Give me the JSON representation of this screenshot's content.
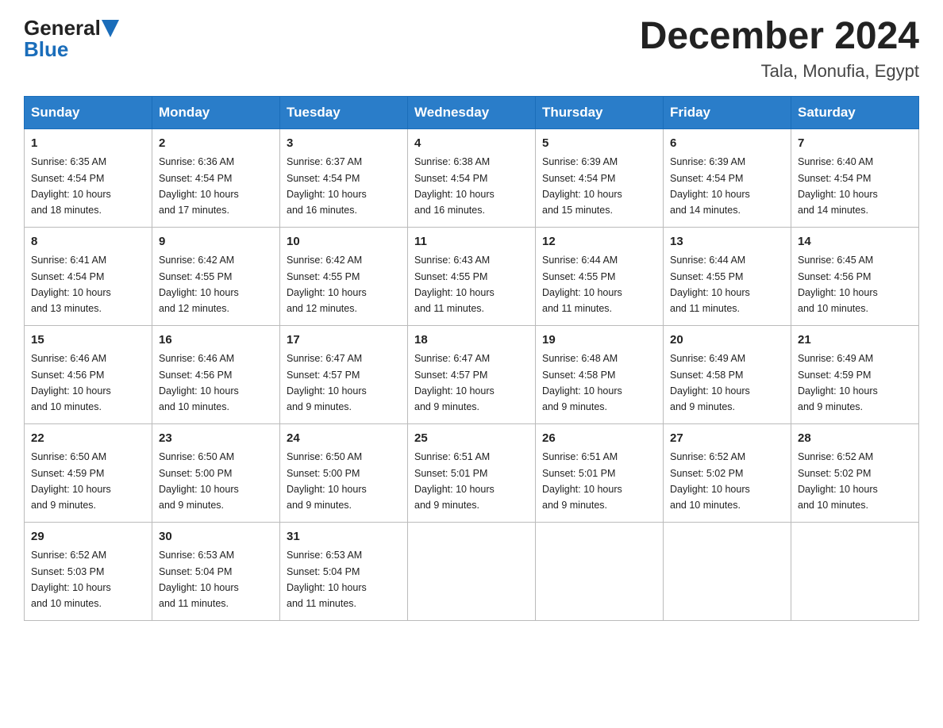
{
  "header": {
    "logo_general": "General",
    "logo_blue": "Blue",
    "title": "December 2024",
    "subtitle": "Tala, Monufia, Egypt"
  },
  "weekdays": [
    "Sunday",
    "Monday",
    "Tuesday",
    "Wednesday",
    "Thursday",
    "Friday",
    "Saturday"
  ],
  "weeks": [
    [
      {
        "day": "1",
        "sunrise": "6:35 AM",
        "sunset": "4:54 PM",
        "daylight": "10 hours and 18 minutes."
      },
      {
        "day": "2",
        "sunrise": "6:36 AM",
        "sunset": "4:54 PM",
        "daylight": "10 hours and 17 minutes."
      },
      {
        "day": "3",
        "sunrise": "6:37 AM",
        "sunset": "4:54 PM",
        "daylight": "10 hours and 16 minutes."
      },
      {
        "day": "4",
        "sunrise": "6:38 AM",
        "sunset": "4:54 PM",
        "daylight": "10 hours and 16 minutes."
      },
      {
        "day": "5",
        "sunrise": "6:39 AM",
        "sunset": "4:54 PM",
        "daylight": "10 hours and 15 minutes."
      },
      {
        "day": "6",
        "sunrise": "6:39 AM",
        "sunset": "4:54 PM",
        "daylight": "10 hours and 14 minutes."
      },
      {
        "day": "7",
        "sunrise": "6:40 AM",
        "sunset": "4:54 PM",
        "daylight": "10 hours and 14 minutes."
      }
    ],
    [
      {
        "day": "8",
        "sunrise": "6:41 AM",
        "sunset": "4:54 PM",
        "daylight": "10 hours and 13 minutes."
      },
      {
        "day": "9",
        "sunrise": "6:42 AM",
        "sunset": "4:55 PM",
        "daylight": "10 hours and 12 minutes."
      },
      {
        "day": "10",
        "sunrise": "6:42 AM",
        "sunset": "4:55 PM",
        "daylight": "10 hours and 12 minutes."
      },
      {
        "day": "11",
        "sunrise": "6:43 AM",
        "sunset": "4:55 PM",
        "daylight": "10 hours and 11 minutes."
      },
      {
        "day": "12",
        "sunrise": "6:44 AM",
        "sunset": "4:55 PM",
        "daylight": "10 hours and 11 minutes."
      },
      {
        "day": "13",
        "sunrise": "6:44 AM",
        "sunset": "4:55 PM",
        "daylight": "10 hours and 11 minutes."
      },
      {
        "day": "14",
        "sunrise": "6:45 AM",
        "sunset": "4:56 PM",
        "daylight": "10 hours and 10 minutes."
      }
    ],
    [
      {
        "day": "15",
        "sunrise": "6:46 AM",
        "sunset": "4:56 PM",
        "daylight": "10 hours and 10 minutes."
      },
      {
        "day": "16",
        "sunrise": "6:46 AM",
        "sunset": "4:56 PM",
        "daylight": "10 hours and 10 minutes."
      },
      {
        "day": "17",
        "sunrise": "6:47 AM",
        "sunset": "4:57 PM",
        "daylight": "10 hours and 9 minutes."
      },
      {
        "day": "18",
        "sunrise": "6:47 AM",
        "sunset": "4:57 PM",
        "daylight": "10 hours and 9 minutes."
      },
      {
        "day": "19",
        "sunrise": "6:48 AM",
        "sunset": "4:58 PM",
        "daylight": "10 hours and 9 minutes."
      },
      {
        "day": "20",
        "sunrise": "6:49 AM",
        "sunset": "4:58 PM",
        "daylight": "10 hours and 9 minutes."
      },
      {
        "day": "21",
        "sunrise": "6:49 AM",
        "sunset": "4:59 PM",
        "daylight": "10 hours and 9 minutes."
      }
    ],
    [
      {
        "day": "22",
        "sunrise": "6:50 AM",
        "sunset": "4:59 PM",
        "daylight": "10 hours and 9 minutes."
      },
      {
        "day": "23",
        "sunrise": "6:50 AM",
        "sunset": "5:00 PM",
        "daylight": "10 hours and 9 minutes."
      },
      {
        "day": "24",
        "sunrise": "6:50 AM",
        "sunset": "5:00 PM",
        "daylight": "10 hours and 9 minutes."
      },
      {
        "day": "25",
        "sunrise": "6:51 AM",
        "sunset": "5:01 PM",
        "daylight": "10 hours and 9 minutes."
      },
      {
        "day": "26",
        "sunrise": "6:51 AM",
        "sunset": "5:01 PM",
        "daylight": "10 hours and 9 minutes."
      },
      {
        "day": "27",
        "sunrise": "6:52 AM",
        "sunset": "5:02 PM",
        "daylight": "10 hours and 10 minutes."
      },
      {
        "day": "28",
        "sunrise": "6:52 AM",
        "sunset": "5:02 PM",
        "daylight": "10 hours and 10 minutes."
      }
    ],
    [
      {
        "day": "29",
        "sunrise": "6:52 AM",
        "sunset": "5:03 PM",
        "daylight": "10 hours and 10 minutes."
      },
      {
        "day": "30",
        "sunrise": "6:53 AM",
        "sunset": "5:04 PM",
        "daylight": "10 hours and 11 minutes."
      },
      {
        "day": "31",
        "sunrise": "6:53 AM",
        "sunset": "5:04 PM",
        "daylight": "10 hours and 11 minutes."
      },
      null,
      null,
      null,
      null
    ]
  ],
  "labels": {
    "sunrise": "Sunrise:",
    "sunset": "Sunset:",
    "daylight": "Daylight:"
  }
}
